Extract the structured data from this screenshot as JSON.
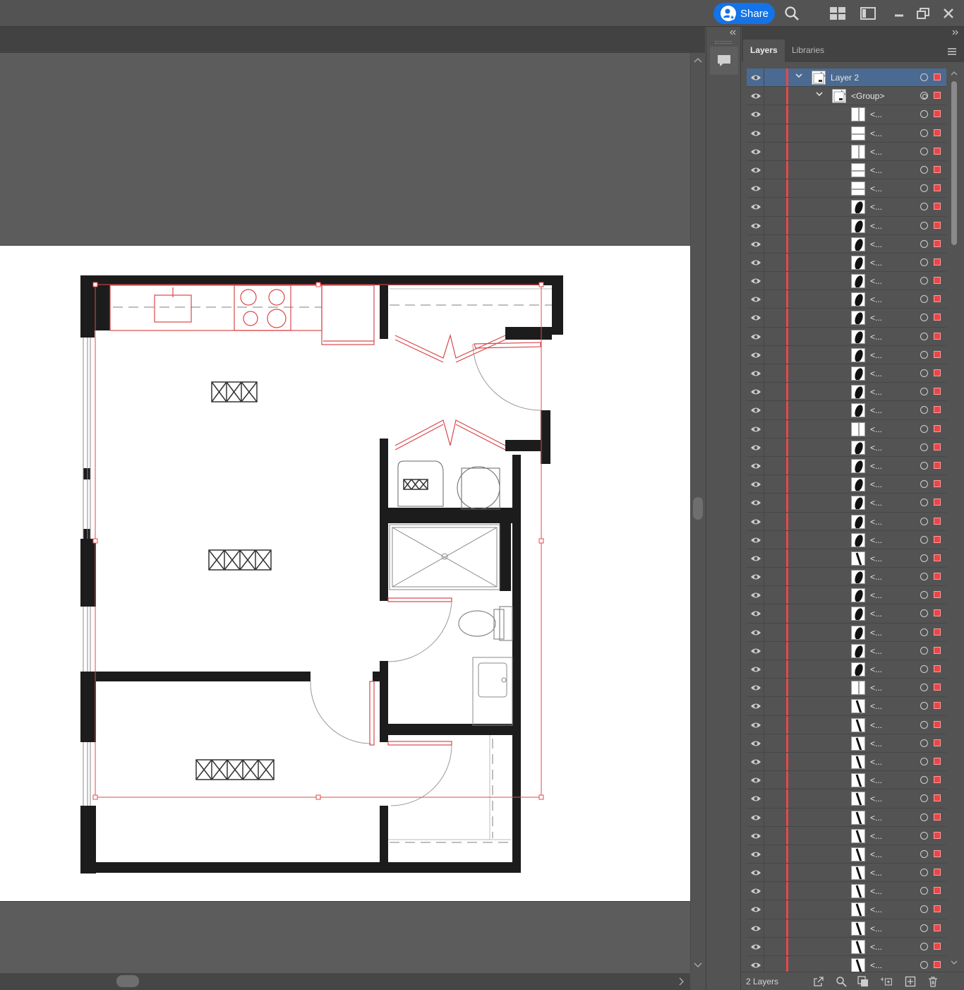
{
  "titlebar": {
    "share_label": "Share",
    "icons": [
      "search-icon",
      "arrange-documents-icon",
      "workspace-icon",
      "minimize-icon",
      "restore-icon",
      "close-icon"
    ]
  },
  "panel": {
    "tabs": [
      {
        "label": "Layers",
        "active": true
      },
      {
        "label": "Libraries",
        "active": false
      }
    ],
    "footer_count": "2 Layers",
    "footer_icons": [
      "export-icon",
      "locate-object-icon",
      "make-clipping-mask-icon",
      "create-sublayer-icon",
      "new-layer-icon",
      "delete-icon"
    ]
  },
  "layers": [
    {
      "name": "Layer 2",
      "level": 0,
      "expanded": true,
      "selected": true,
      "thumb": "layer"
    },
    {
      "name": "<Group>",
      "level": 1,
      "expanded": true,
      "selected": false,
      "thumb": "layer"
    },
    {
      "name": "<...",
      "level": 2,
      "thumb": "v"
    },
    {
      "name": "<...",
      "level": 2,
      "thumb": "h"
    },
    {
      "name": "<...",
      "level": 2,
      "thumb": "v"
    },
    {
      "name": "<...",
      "level": 2,
      "thumb": "h"
    },
    {
      "name": "<...",
      "level": 2,
      "thumb": "h"
    },
    {
      "name": "<...",
      "level": 2,
      "thumb": "blob"
    },
    {
      "name": "<...",
      "level": 2,
      "thumb": "blob"
    },
    {
      "name": "<...",
      "level": 2,
      "thumb": "blob"
    },
    {
      "name": "<...",
      "level": 2,
      "thumb": "blob"
    },
    {
      "name": "<...",
      "level": 2,
      "thumb": "blob"
    },
    {
      "name": "<...",
      "level": 2,
      "thumb": "blob"
    },
    {
      "name": "<...",
      "level": 2,
      "thumb": "blob"
    },
    {
      "name": "<...",
      "level": 2,
      "thumb": "blob"
    },
    {
      "name": "<...",
      "level": 2,
      "thumb": "blob"
    },
    {
      "name": "<...",
      "level": 2,
      "thumb": "blob"
    },
    {
      "name": "<...",
      "level": 2,
      "thumb": "blob"
    },
    {
      "name": "<...",
      "level": 2,
      "thumb": "blob"
    },
    {
      "name": "<...",
      "level": 2,
      "thumb": "v"
    },
    {
      "name": "<...",
      "level": 2,
      "thumb": "blob"
    },
    {
      "name": "<...",
      "level": 2,
      "thumb": "blob"
    },
    {
      "name": "<...",
      "level": 2,
      "thumb": "blob"
    },
    {
      "name": "<...",
      "level": 2,
      "thumb": "blob"
    },
    {
      "name": "<...",
      "level": 2,
      "thumb": "blob"
    },
    {
      "name": "<...",
      "level": 2,
      "thumb": "blob"
    },
    {
      "name": "<...",
      "level": 2,
      "thumb": "line"
    },
    {
      "name": "<...",
      "level": 2,
      "thumb": "blob"
    },
    {
      "name": "<...",
      "level": 2,
      "thumb": "blob"
    },
    {
      "name": "<...",
      "level": 2,
      "thumb": "blob"
    },
    {
      "name": "<...",
      "level": 2,
      "thumb": "blob"
    },
    {
      "name": "<...",
      "level": 2,
      "thumb": "blob"
    },
    {
      "name": "<...",
      "level": 2,
      "thumb": "blob"
    },
    {
      "name": "<...",
      "level": 2,
      "thumb": "v"
    },
    {
      "name": "<...",
      "level": 2,
      "thumb": "line"
    },
    {
      "name": "<...",
      "level": 2,
      "thumb": "line"
    },
    {
      "name": "<...",
      "level": 2,
      "thumb": "line"
    },
    {
      "name": "<...",
      "level": 2,
      "thumb": "line"
    },
    {
      "name": "<...",
      "level": 2,
      "thumb": "line"
    },
    {
      "name": "<...",
      "level": 2,
      "thumb": "line"
    },
    {
      "name": "<...",
      "level": 2,
      "thumb": "line"
    },
    {
      "name": "<...",
      "level": 2,
      "thumb": "line"
    },
    {
      "name": "<...",
      "level": 2,
      "thumb": "line"
    },
    {
      "name": "<...",
      "level": 2,
      "thumb": "line"
    },
    {
      "name": "<...",
      "level": 2,
      "thumb": "line"
    },
    {
      "name": "<...",
      "level": 2,
      "thumb": "line"
    },
    {
      "name": "<...",
      "level": 2,
      "thumb": "line"
    },
    {
      "name": "<...",
      "level": 2,
      "thumb": "line"
    },
    {
      "name": "<...",
      "level": 2,
      "thumb": "line"
    },
    {
      "name": "<...",
      "level": 2,
      "thumb": "line"
    }
  ],
  "colors": {
    "selection_red": "#e8474a",
    "accent_blue": "#1473e6",
    "selected_row": "#4b6a91"
  }
}
